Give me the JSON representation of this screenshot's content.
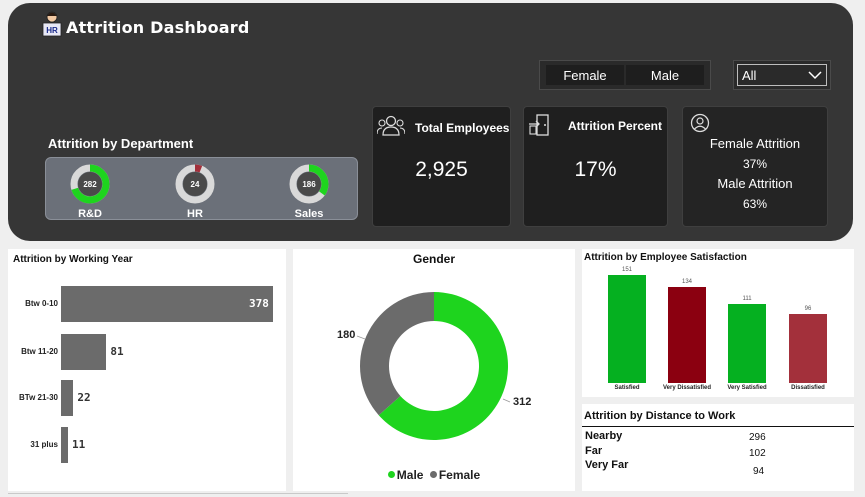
{
  "header": {
    "title": "Attrition Dashboard",
    "logo_text": "HR"
  },
  "filters": {
    "gender_options": [
      "Female",
      "Male"
    ],
    "dropdown_value": "All"
  },
  "department": {
    "title": "Attrition by Department",
    "items": [
      {
        "label": "R&D",
        "value": "282",
        "fraction": 0.7
      },
      {
        "label": "HR",
        "value": "24",
        "fraction": 0.06
      },
      {
        "label": "Sales",
        "value": "186",
        "fraction": 0.35
      }
    ]
  },
  "kpis": {
    "total_employees": {
      "label": "Total Employees",
      "value": "2,925"
    },
    "attrition_percent": {
      "label": "Attrition Percent",
      "value": "17%"
    },
    "gender_attrition": {
      "female_label": "Female Attrition",
      "female_value": "37%",
      "male_label": "Male Attrition",
      "male_value": "63%"
    }
  },
  "colors": {
    "green": "#1ed41e",
    "gray": "#6b6b6b",
    "dark_green": "#05b020",
    "dark_red": "#8b0010",
    "red": "#a3303b"
  },
  "chart_data": [
    {
      "type": "bar",
      "orientation": "horizontal",
      "title": "Attrition by Working Year",
      "categories": [
        "Btw 0-10",
        "Btw 11-20",
        "BTw 21-30",
        "31 plus"
      ],
      "values": [
        378,
        81,
        22,
        11
      ]
    },
    {
      "type": "pie",
      "donut": true,
      "title": "Gender",
      "categories": [
        "Male",
        "Female"
      ],
      "values": [
        312,
        180
      ],
      "legend": "bottom"
    },
    {
      "type": "bar",
      "title": "Attrition by Employee Satisfaction",
      "categories": [
        "Satisfied",
        "Very Dissatisfied",
        "Very Satisfied",
        "Dissatisfied"
      ],
      "values": [
        151,
        134,
        111,
        96
      ]
    },
    {
      "type": "table",
      "title": "Attrition by Distance to Work",
      "categories": [
        "Nearby",
        "Far",
        "Very Far"
      ],
      "values": [
        296,
        102,
        94
      ]
    }
  ]
}
